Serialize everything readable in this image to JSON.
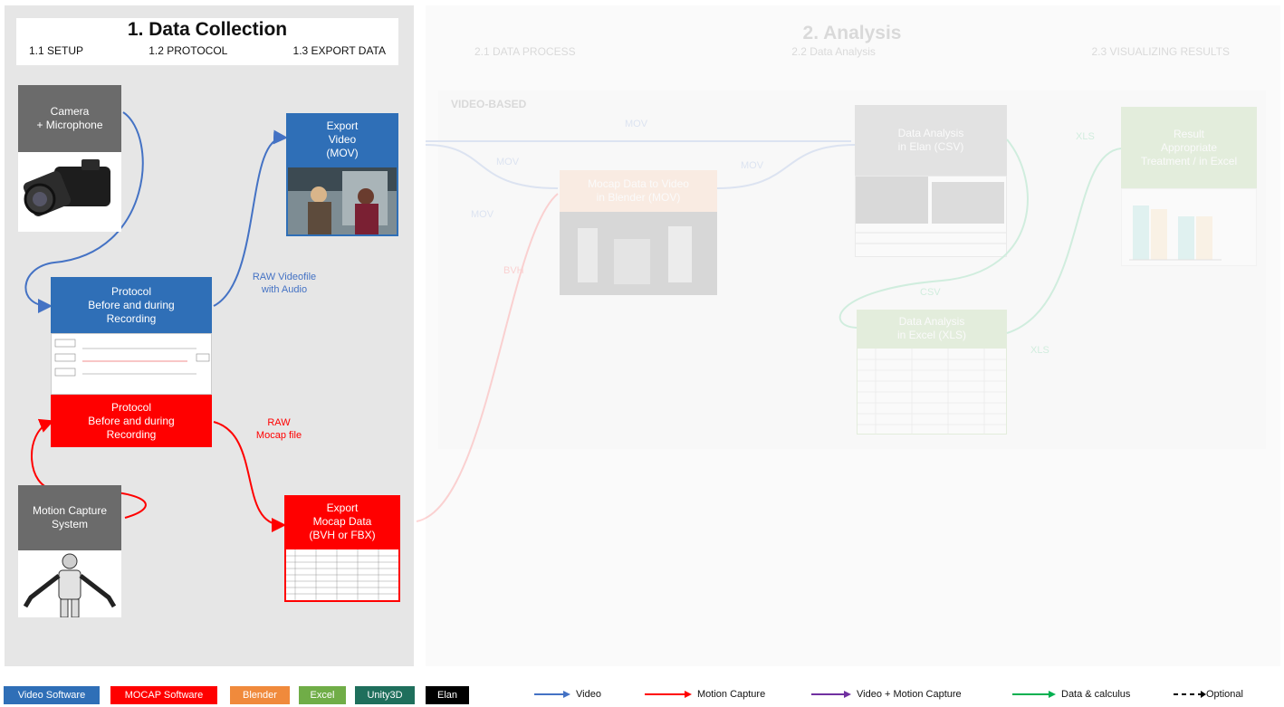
{
  "collection": {
    "title": "1. Data Collection",
    "subs": [
      "1.1 SETUP",
      "1.2 PROTOCOL",
      "1.3 EXPORT DATA"
    ]
  },
  "analysis": {
    "title": "2. Analysis",
    "subs": [
      "2.1 DATA PROCESS",
      "2.2 Data Analysis",
      "2.3 VISUALIZING  RESULTS"
    ],
    "area_label": "VIDEO-BASED"
  },
  "boxes": {
    "camera": [
      "Camera",
      "+ Microphone"
    ],
    "protocol_blue": [
      "Protocol",
      "Before and during",
      "Recording"
    ],
    "protocol_red": [
      "Protocol",
      "Before and during",
      "Recording"
    ],
    "motion_capture": [
      "Motion Capture",
      "System"
    ],
    "export_video": [
      "Export",
      "Video",
      "(MOV)"
    ],
    "export_mocap": [
      "Export",
      "Mocap Data",
      "(BVH or FBX)"
    ],
    "mocap_to_video": [
      "Mocap Data to Video",
      "in Blender (MOV)"
    ],
    "elan": [
      "Data Analysis",
      "in Elan (CSV)"
    ],
    "excel": [
      "Data Analysis",
      "in Excel (XLS)"
    ],
    "result": [
      "Result",
      "Appropriate",
      "Treatment / in Excel"
    ]
  },
  "labels": {
    "raw_video": [
      "RAW Videofile",
      "with Audio"
    ],
    "raw_mocap": [
      "RAW",
      "Mocap file"
    ],
    "mov1": "MOV",
    "mov2": "MOV",
    "mov3": "MOV",
    "mov4": "MOV",
    "bvh": "BVH",
    "csv": "CSV",
    "xls1": "XLS",
    "xls2": "XLS"
  },
  "legend": {
    "chips": [
      {
        "label": "Video Software",
        "color": "#2f6fb7"
      },
      {
        "label": "MOCAP Software",
        "color": "#ff0000"
      },
      {
        "label": "Blender",
        "color": "#f08a3c"
      },
      {
        "label": "Excel",
        "color": "#70ad47"
      },
      {
        "label": "Unity3D",
        "color": "#1f6f5c"
      },
      {
        "label": "Elan",
        "color": "#000000"
      }
    ],
    "arrows": [
      {
        "label": "Video",
        "color": "#4472c4"
      },
      {
        "label": "Motion Capture",
        "color": "#ff0000"
      },
      {
        "label": "Video + Motion Capture",
        "color": "#7030a0"
      },
      {
        "label": "Data & calculus",
        "color": "#00b050"
      },
      {
        "label": "Optional",
        "color": "#000000"
      }
    ]
  }
}
